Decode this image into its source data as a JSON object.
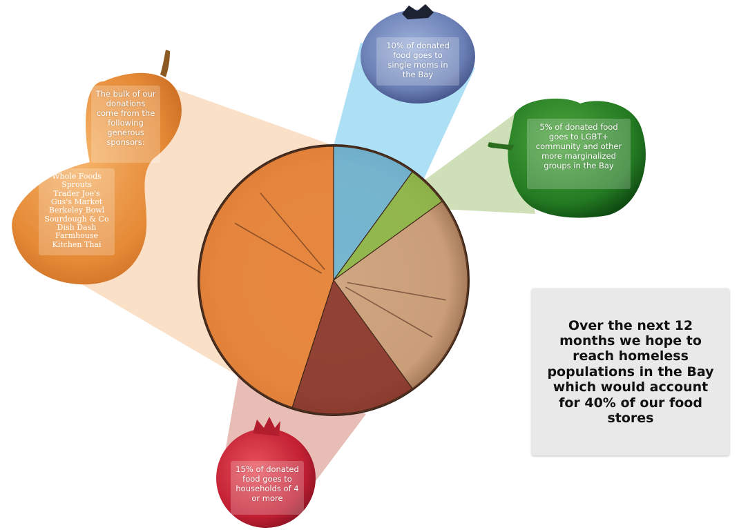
{
  "colors": {
    "sponsors": "#e9853a",
    "single_moms": "#6fb7d6",
    "lgbt": "#8db94a",
    "households": "#8c3a2e",
    "homeless": "#caa17e",
    "squash": "#e9944a",
    "blueberry": "#6f84b7",
    "pepper": "#2f8a2a",
    "pomegranate": "#c8263a",
    "wedge_sponsors": "#fbe0c8",
    "wedge_moms": "#aee0f5",
    "wedge_lgbt": "#cfe0b8",
    "wedge_households": "#e8bdb6"
  },
  "labels": {
    "sponsors_intro": "The bulk of our donations come from the following generous sponsors:",
    "single_moms": "10% of donated food goes to single moms in the Bay",
    "lgbt": "5% of donated food goes to LGBT+ community and other more marginalized groups in the Bay",
    "households": "15% of donated food goes to households of 4 or more"
  },
  "sponsors": [
    "Whole Foods",
    "Sprouts",
    "Trader Joe's",
    "Gus's Market",
    "Berkeley Bowl",
    "Sourdough & Co",
    "Dish Dash",
    "Farmhouse",
    "Kitchen Thai"
  ],
  "callout": "Over the next 12 months we hope to reach homeless populations in the Bay which would account for 40% of our food stores",
  "icons": [
    "butternut-squash-icon",
    "blueberry-icon",
    "green-pepper-icon",
    "pomegranate-icon",
    "pie-icon"
  ],
  "chart_data": {
    "type": "pie",
    "start_angle_deg": 0,
    "direction": "clockwise",
    "slices": [
      {
        "label": "Single moms",
        "value": 10
      },
      {
        "label": "LGBT+ and marginalized groups",
        "value": 5
      },
      {
        "label": "Homeless populations",
        "value": 25
      },
      {
        "label": "Households of 4 or more",
        "value": 15
      },
      {
        "label": "Sponsors",
        "value": 45
      }
    ]
  }
}
